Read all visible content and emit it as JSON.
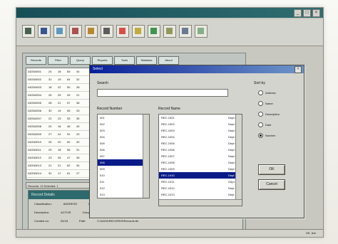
{
  "app": {
    "title": "",
    "controls": [
      "_",
      "□",
      "×"
    ]
  },
  "toolbar": {
    "icons": [
      {
        "name": "save-icon",
        "color": "#36523f"
      },
      {
        "name": "floppy-icon",
        "color": "#25458a"
      },
      {
        "name": "print-icon",
        "color": "#4d8fc2"
      },
      {
        "name": "scissors-icon",
        "color": "#a64040"
      },
      {
        "name": "copy-icon",
        "color": "#b37d1d"
      },
      {
        "name": "paste-icon",
        "color": "#4d4f4f"
      },
      {
        "name": "undo-icon",
        "color": "#d33d36"
      },
      {
        "name": "redo-icon",
        "color": "#bba52c"
      },
      {
        "name": "help-icon",
        "color": "#2b8b40"
      },
      {
        "name": "grid-icon",
        "color": "#888f4f"
      },
      {
        "name": "chart-icon",
        "color": "#5b6f8a"
      },
      {
        "name": "zoom-icon",
        "color": "#7aa87c"
      }
    ]
  },
  "tabs": [
    "Records",
    "Filter",
    "Query",
    "Reports",
    "Tools",
    "Statistics",
    "About"
  ],
  "grid": {
    "rows": [
      [
        "DATA0001",
        "24",
        "18",
        "65",
        "44"
      ],
      [
        "DATA0002",
        "31",
        "19",
        "64",
        "32"
      ],
      [
        "DATA0003",
        "18",
        "22",
        "50",
        "28"
      ],
      [
        "DATA0004",
        "26",
        "25",
        "49",
        "21"
      ],
      [
        "DATA0005",
        "28",
        "21",
        "57",
        "38"
      ],
      [
        "DATA0006",
        "30",
        "19",
        "55",
        "33"
      ],
      [
        "DATA0007",
        "22",
        "23",
        "53",
        "35"
      ],
      [
        "DATA0008",
        "20",
        "16",
        "46",
        "40"
      ],
      [
        "DATA0009",
        "27",
        "24",
        "51",
        "29"
      ],
      [
        "DATA0010",
        "25",
        "20",
        "60",
        "30"
      ],
      [
        "DATA0011",
        "29",
        "18",
        "58",
        "31"
      ],
      [
        "DATA0012",
        "23",
        "26",
        "47",
        "36"
      ],
      [
        "DATA0013",
        "21",
        "21",
        "62",
        "34"
      ],
      [
        "DATA0014",
        "32",
        "17",
        "61",
        "27"
      ]
    ],
    "status": "Records: 13   Selected: 1"
  },
  "bottom_panel": {
    "title": "Record Details",
    "lines": [
      [
        "Classification:",
        "ADDRESS",
        "Code:",
        "ABR-104"
      ],
      [
        "Description:",
        "ACTIVE",
        "Group:",
        "FRA-09"
      ],
      [
        "Created on:",
        "04/18",
        "Path:",
        "C:\\DATA\\RECORDS\\Records.tbl"
      ]
    ]
  },
  "dialog": {
    "title": "Select",
    "search_label": "Search",
    "search_value": "",
    "left_list_title": "Record Number",
    "left_items": [
      "001",
      "002",
      "003",
      "004",
      "005",
      "006",
      "007",
      "008",
      "009",
      "010",
      "011",
      "012",
      "013",
      "014",
      "015"
    ],
    "left_selected_index": 7,
    "right_list_title": "Record Name",
    "right_items": [
      [
        "REC-1001",
        "Dept 01"
      ],
      [
        "REC-1002",
        "Dept 02"
      ],
      [
        "REC-1003",
        "Dept 03"
      ],
      [
        "REC-1004",
        "Dept 04"
      ],
      [
        "REC-1005",
        "Dept 05"
      ],
      [
        "REC-1006",
        "Dept 06"
      ],
      [
        "REC-1007",
        "Dept 07"
      ],
      [
        "REC-1008",
        "Dept 08"
      ],
      [
        "REC-1009",
        "Dept 09"
      ],
      [
        "REC-1010",
        "Dept 10"
      ],
      [
        "REC-1011",
        "Dept 11"
      ],
      [
        "REC-1012",
        "Dept 12"
      ],
      [
        "REC-1013",
        "Dept 13"
      ],
      [
        "REC-1014",
        "Dept 14"
      ]
    ],
    "right_selected_index": 9,
    "radios_title": "Sort by",
    "radios": [
      "Address",
      "Name",
      "Description",
      "Date",
      "Number"
    ],
    "radio_checked_index": 4,
    "ok_label": "OK",
    "cancel_label": "Cancel"
  },
  "footer": {
    "status": "OK, line"
  }
}
